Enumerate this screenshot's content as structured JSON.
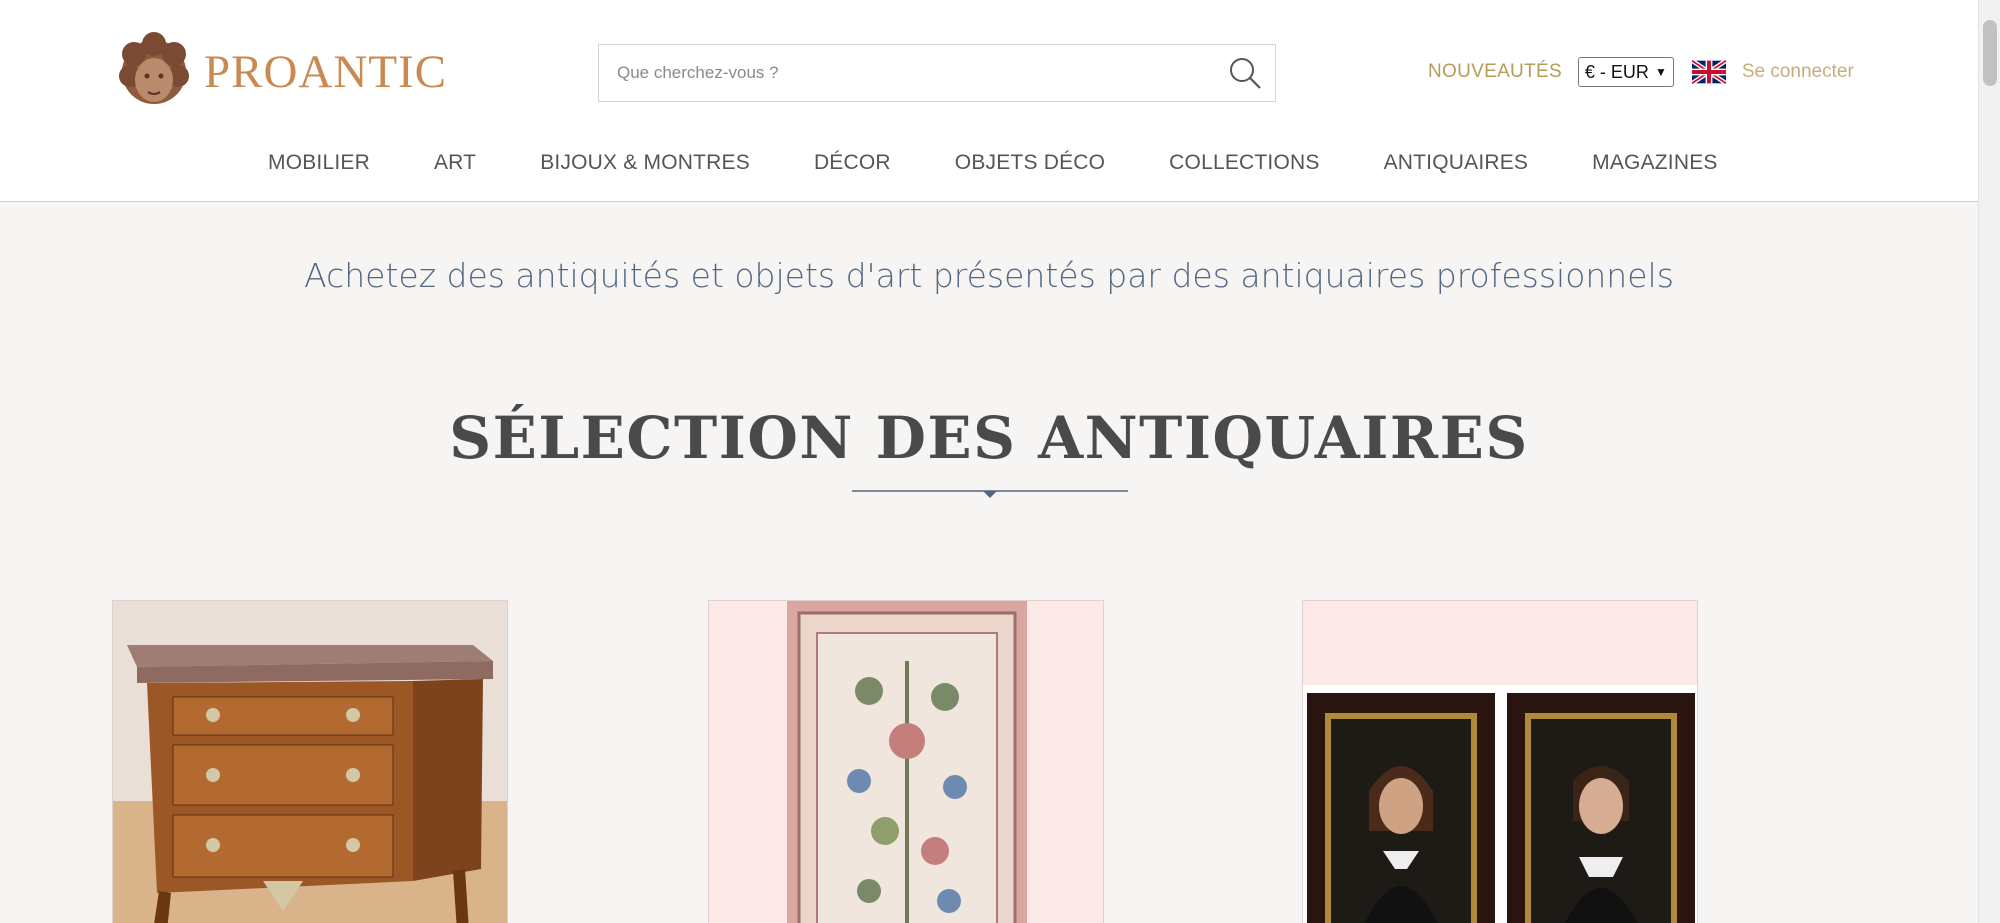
{
  "header": {
    "logo_text": "PROANTIC",
    "search_placeholder": "Que cherchez-vous ?",
    "new_label": "NOUVEAUTÉS",
    "currency": "€ - EUR",
    "language_icon": "uk-flag-icon",
    "login_label": "Se connecter"
  },
  "nav": {
    "items": [
      "MOBILIER",
      "ART",
      "BIJOUX & MONTRES",
      "DÉCOR",
      "OBJETS DÉCO",
      "COLLECTIONS",
      "ANTIQUAIRES",
      "MAGAZINES"
    ]
  },
  "tagline": "Achetez des antiquités et objets d'art présentés par des antiquaires professionnels",
  "section": {
    "title": "SÉLECTION DES ANTIQUAIRES"
  },
  "products": [
    {
      "image": "marquetry-commode"
    },
    {
      "image": "floral-tree-rug"
    },
    {
      "image": "pair-of-portraits"
    }
  ],
  "colors": {
    "brand": "#c98a52",
    "gold": "#b89a5a",
    "login": "#c7ad7c",
    "tagline": "#536781",
    "background": "#f6f5f3"
  }
}
